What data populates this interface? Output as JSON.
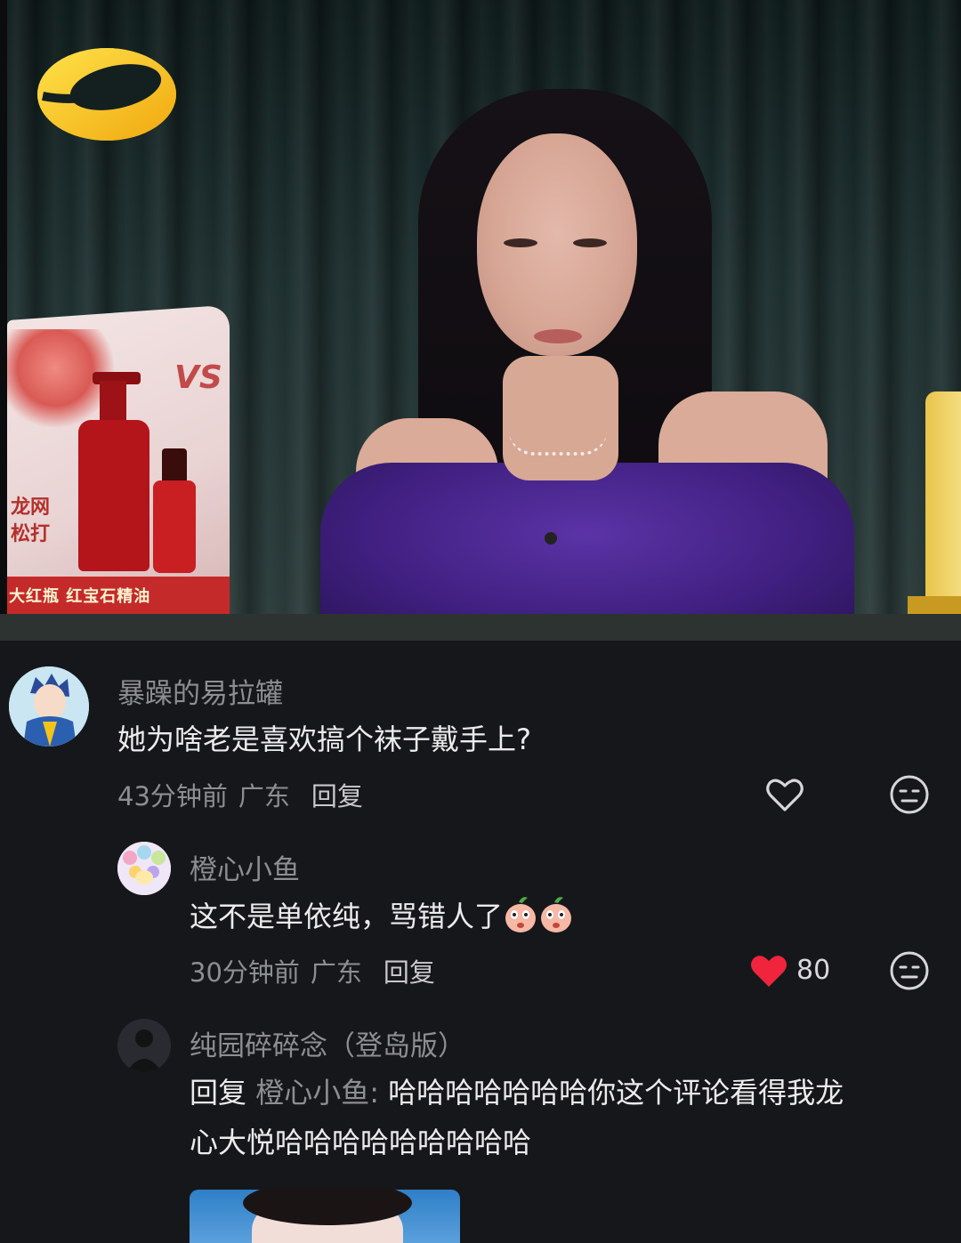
{
  "video": {
    "station_logo": "mango-tv-logo",
    "product_brand": "VS",
    "product_board_text_line1": "龙网",
    "product_board_text_line2": "松打",
    "product_base_text": "大红瓶  红宝石精油"
  },
  "comments": [
    {
      "username": "暴躁的易拉罐",
      "text": "她为啥老是喜欢搞个袜子戴手上?",
      "time": "43分钟前",
      "location": "广东",
      "reply_label": "回复",
      "liked": false,
      "like_count": ""
    },
    {
      "username": "橙心小鱼",
      "text": "这不是单依纯，骂错人了",
      "emoji": [
        "peach-face-emoji",
        "peach-face-emoji"
      ],
      "time": "30分钟前",
      "location": "广东",
      "reply_label": "回复",
      "liked": true,
      "like_count": "80"
    },
    {
      "username": "纯园碎碎念（登岛版）",
      "reply_prefix": "回复",
      "reply_to": "橙心小鱼:",
      "text_line1": "哈哈哈哈哈哈哈你这个评论看得我龙",
      "text_line2": "心大悦哈哈哈哈哈哈哈哈哈"
    }
  ],
  "colors": {
    "background": "#16171b",
    "text_primary": "#ececec",
    "text_secondary": "#8d8e92",
    "like_red": "#f0243c"
  }
}
